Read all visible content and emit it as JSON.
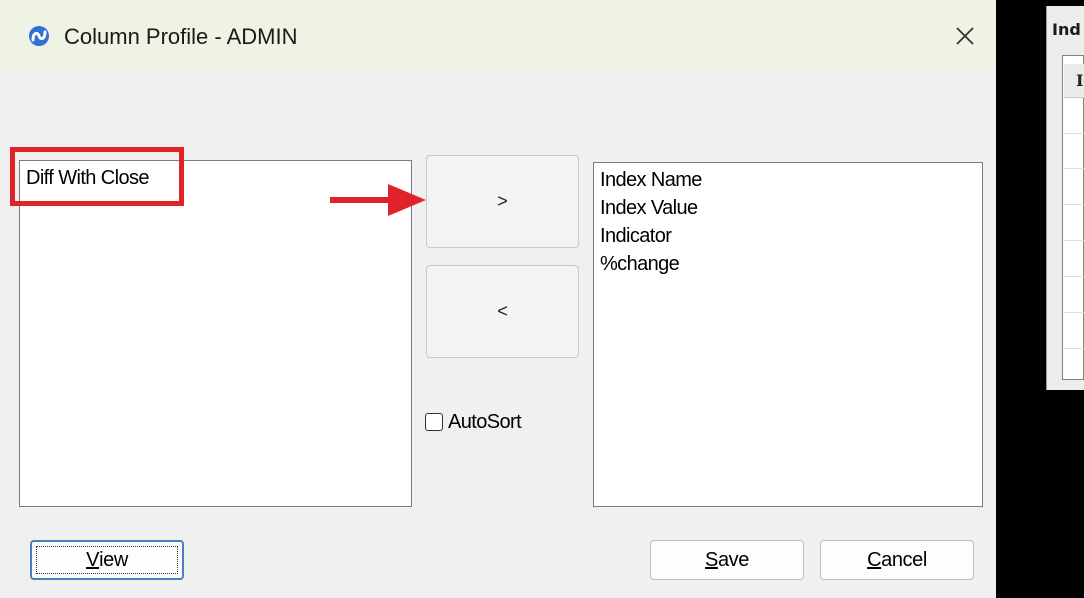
{
  "dialog": {
    "title": "Column Profile - ADMIN",
    "close_glyph": "✕"
  },
  "available_columns": {
    "items": [
      "Diff With Close"
    ]
  },
  "selected_columns": {
    "items": [
      "Index Name",
      "Index Value",
      "Indicator",
      "%change"
    ]
  },
  "transfer": {
    "add_label": ">",
    "remove_label": "<"
  },
  "autosort": {
    "label": "AutoSort",
    "checked": false
  },
  "buttons": {
    "view_mnemonic": "V",
    "view_rest": "iew",
    "save_mnemonic": "S",
    "save_rest": "ave",
    "cancel_mnemonic": "C",
    "cancel_rest": "ancel"
  },
  "background_window": {
    "title": "Ind",
    "header": "I"
  },
  "colors": {
    "annotation": "#e0232a",
    "titlebar": "#eef3e3",
    "dialog": "#f0f0f0"
  }
}
